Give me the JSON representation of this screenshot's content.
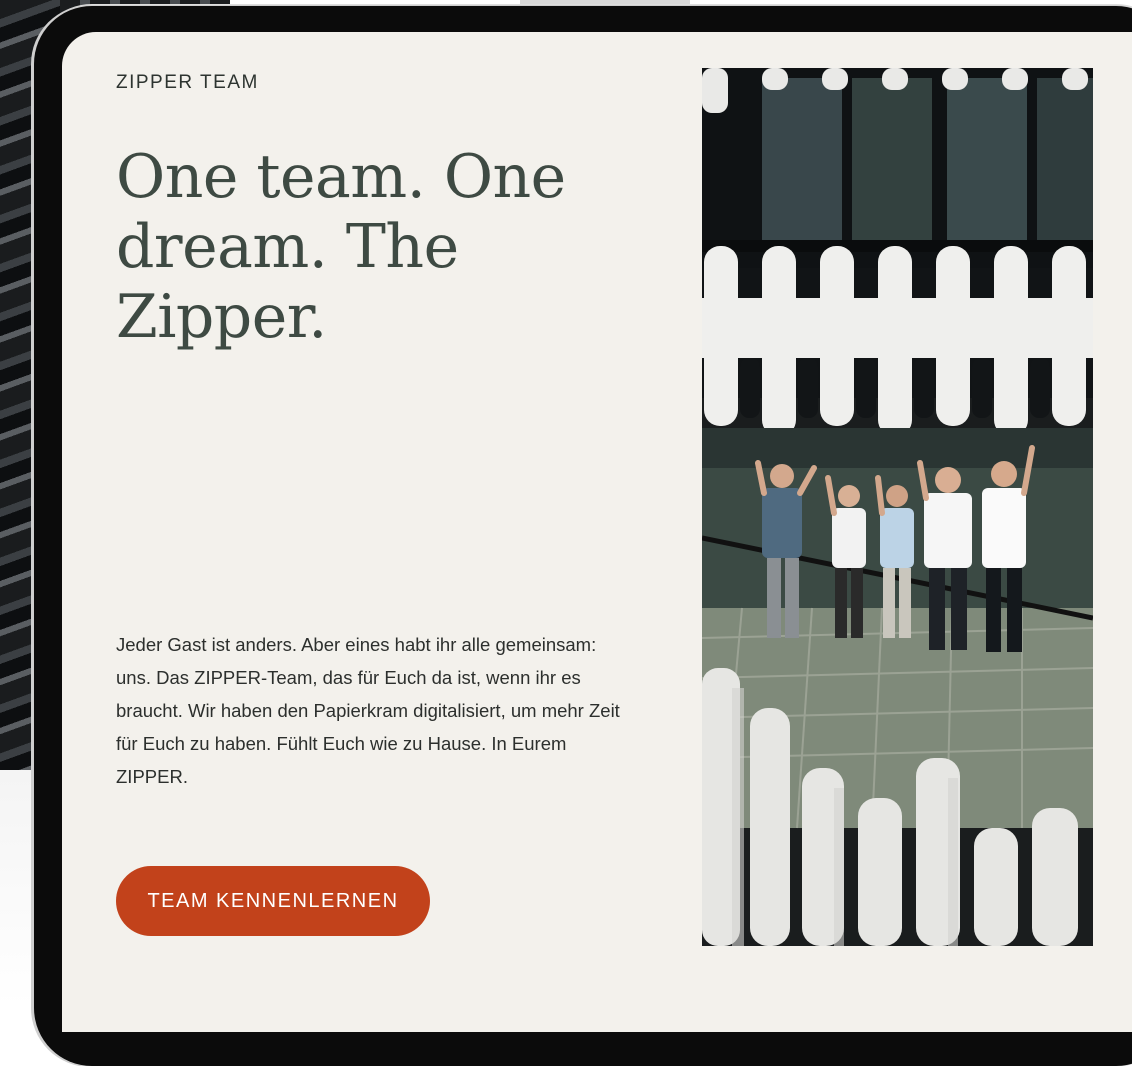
{
  "section": {
    "eyebrow": "ZIPPER TEAM",
    "headline": "One team. One dream. The Zipper.",
    "body": "Jeder Gast ist anders. Aber eines habt ihr alle gemeinsam: uns. Das ZIPPER-Team, das für Euch da ist, wenn ihr es braucht. Wir haben den Papierkram digitalisiert, um mehr Zeit für Euch zu haben. Fühlt Euch wie zu Hause. In Eurem ZIPPER.",
    "cta_label": "TEAM KENNENLERNEN"
  },
  "colors": {
    "page_background": "#f3f1ec",
    "headline": "#3e4a43",
    "cta_background": "#c2421b",
    "cta_text": "#ffffff"
  },
  "photo": {
    "subject": "team-photo"
  }
}
